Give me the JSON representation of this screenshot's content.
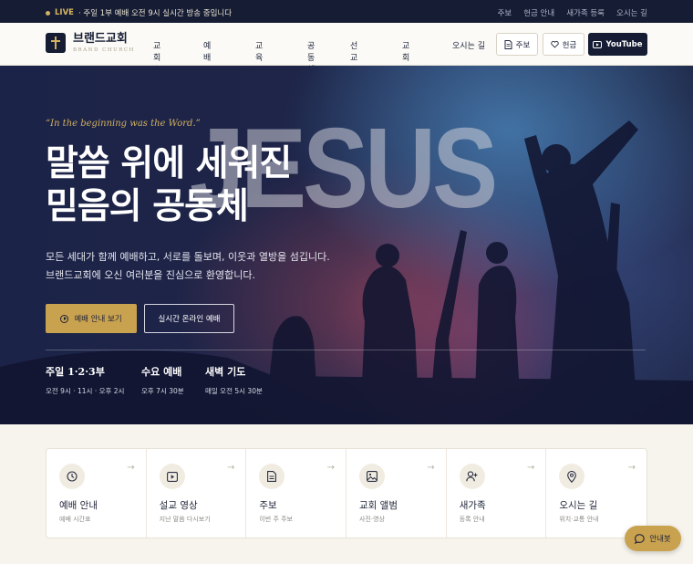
{
  "topbar": {
    "live_label": "LIVE",
    "live_text": " · 주일 1부 예배 오전 9시 실시간 방송 중입니다",
    "links": [
      "주보",
      "헌금 안내",
      "새가족 등록",
      "오시는 길"
    ]
  },
  "header": {
    "logo_name": "브랜드교회",
    "logo_sub": "BRAND CHURCH",
    "nav": [
      "교회소개",
      "예배·설교",
      "교육·양육",
      "공동체",
      "선교·나눔",
      "교회소식",
      "오시는 길"
    ],
    "bulletin_label": "주보",
    "offering_label": "헌금",
    "youtube_label": "YouTube"
  },
  "hero": {
    "quote": "“In the beginning was the Word.”",
    "bg_word": "JESUS",
    "title_line1": "말씀 위에 세워진",
    "title_line2": "믿음의 공동체",
    "desc_line1": "모든 세대가 함께 예배하고, 서로를 돌보며, 이웃과 열방을 섬깁니다.",
    "desc_line2": "브랜드교회에 오신 여러분을 진심으로 환영합니다.",
    "primary_button": "예배 안내 보기",
    "secondary_button": "실시간 온라인 예배",
    "schedule": [
      {
        "name": "주일 1·2·3부",
        "time": "오전 9시 · 11시 · 오후 2시"
      },
      {
        "name": "수요 예배",
        "time": "오후 7시 30분"
      },
      {
        "name": "새벽 기도",
        "time": "매일 오전 5시 30분"
      }
    ]
  },
  "quick_links": [
    {
      "icon": "clock-icon",
      "title": "예배 안내",
      "sub": "예배 시간표"
    },
    {
      "icon": "video-icon",
      "title": "설교 영상",
      "sub": "지난 말씀 다시보기"
    },
    {
      "icon": "document-icon",
      "title": "주보",
      "sub": "이번 주 주보"
    },
    {
      "icon": "image-icon",
      "title": "교회 앨범",
      "sub": "사진·영상"
    },
    {
      "icon": "user-plus-icon",
      "title": "새가족",
      "sub": "등록 안내"
    },
    {
      "icon": "map-pin-icon",
      "title": "오시는 길",
      "sub": "위치·교통 안내"
    }
  ],
  "chatbot_label": "안내봇",
  "colors": {
    "navy": "#151c33",
    "gold": "#c9a24f",
    "cream": "#f7f4ee"
  }
}
